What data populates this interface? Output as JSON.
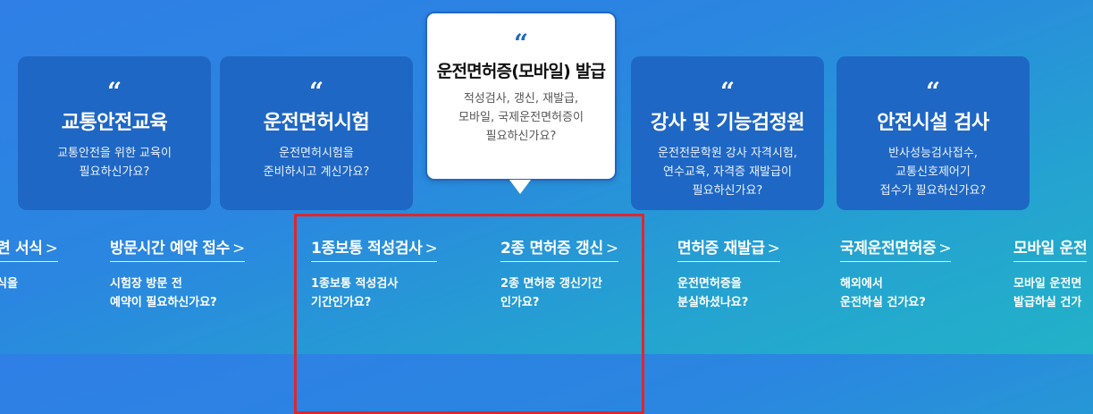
{
  "cards": [
    {
      "title": "교통안전교육",
      "desc": "교통안전을 위한 교육이\n필요하신가요?"
    },
    {
      "title": "운전면허시험",
      "desc": "운전면허시험을\n준비하시고 계신가요?"
    },
    {
      "title": "운전면허증(모바일) 발급",
      "desc": "적성검사, 갱신, 재발급,\n모바일, 국제운전면허증이\n필요하신가요?"
    },
    {
      "title": "강사 및 기능검정원",
      "desc": "운전전문학원 강사 자격시험,\n연수교육, 자격증 재발급이\n필요하신가요?"
    },
    {
      "title": "안전시설 검사",
      "desc": "반사성능검사접수,\n교통신호제어기\n접수가 필요하신가요?"
    }
  ],
  "quote_glyph": "“",
  "chevron": ">",
  "links": [
    {
      "title": "련 서식",
      "desc": "식을"
    },
    {
      "title": "방문시간 예약 접수",
      "desc": "시험장 방문 전\n예약이 필요하신가요?"
    },
    {
      "title": "1종보통 적성검사",
      "desc": "1종보통 적성검사\n기간인가요?"
    },
    {
      "title": "2종 면허증 갱신",
      "desc": "2종 면허증 갱신기간\n인가요?"
    },
    {
      "title": "면허증 재발급",
      "desc": "운전면허증을\n분실하셨나요?"
    },
    {
      "title": "국제운전면허증",
      "desc": "해외에서\n운전하실 건가요?"
    },
    {
      "title": "모바일 운전",
      "desc": "모바일 운전면\n발급하실 건가"
    }
  ],
  "colors": {
    "card_bg": "#1f67c4",
    "highlight": "#e0262c"
  }
}
